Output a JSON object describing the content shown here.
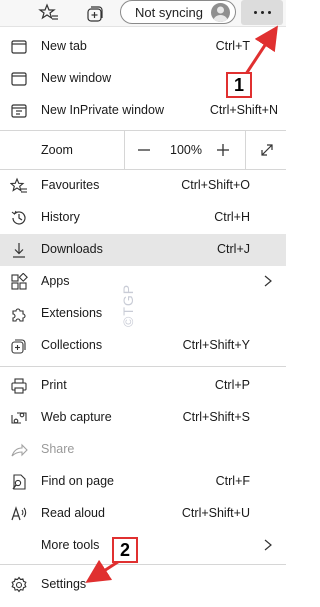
{
  "toolbar": {
    "sync_label": "Not syncing",
    "icons": [
      "favorites-star-icon",
      "collections-icon",
      "avatar-icon",
      "more-menu-icon"
    ]
  },
  "menu": {
    "new_tab": {
      "label": "New tab",
      "shortcut": "Ctrl+T"
    },
    "new_window": {
      "label": "New window",
      "shortcut": "Ct"
    },
    "new_inprivate": {
      "label": "New InPrivate window",
      "shortcut": "Ctrl+Shift+N"
    },
    "zoom": {
      "label": "Zoom",
      "value": "100%"
    },
    "favourites": {
      "label": "Favourites",
      "shortcut": "Ctrl+Shift+O"
    },
    "history": {
      "label": "History",
      "shortcut": "Ctrl+H"
    },
    "downloads": {
      "label": "Downloads",
      "shortcut": "Ctrl+J"
    },
    "apps": {
      "label": "Apps"
    },
    "extensions": {
      "label": "Extensions"
    },
    "collections": {
      "label": "Collections",
      "shortcut": "Ctrl+Shift+Y"
    },
    "print": {
      "label": "Print",
      "shortcut": "Ctrl+P"
    },
    "web_capture": {
      "label": "Web capture",
      "shortcut": "Ctrl+Shift+S"
    },
    "share": {
      "label": "Share"
    },
    "find_on_page": {
      "label": "Find on page",
      "shortcut": "Ctrl+F"
    },
    "read_aloud": {
      "label": "Read aloud",
      "shortcut": "Ctrl+Shift+U"
    },
    "more_tools": {
      "label": "More tools"
    },
    "settings": {
      "label": "Settings"
    }
  },
  "annotations": {
    "callout_1": "1",
    "callout_2": "2",
    "watermark": "©TGP",
    "color": "#e03030"
  },
  "colors": {
    "highlight": "#e6e6e6",
    "menu_button_bg": "#dcdcdc",
    "callout_border": "#e03030"
  }
}
